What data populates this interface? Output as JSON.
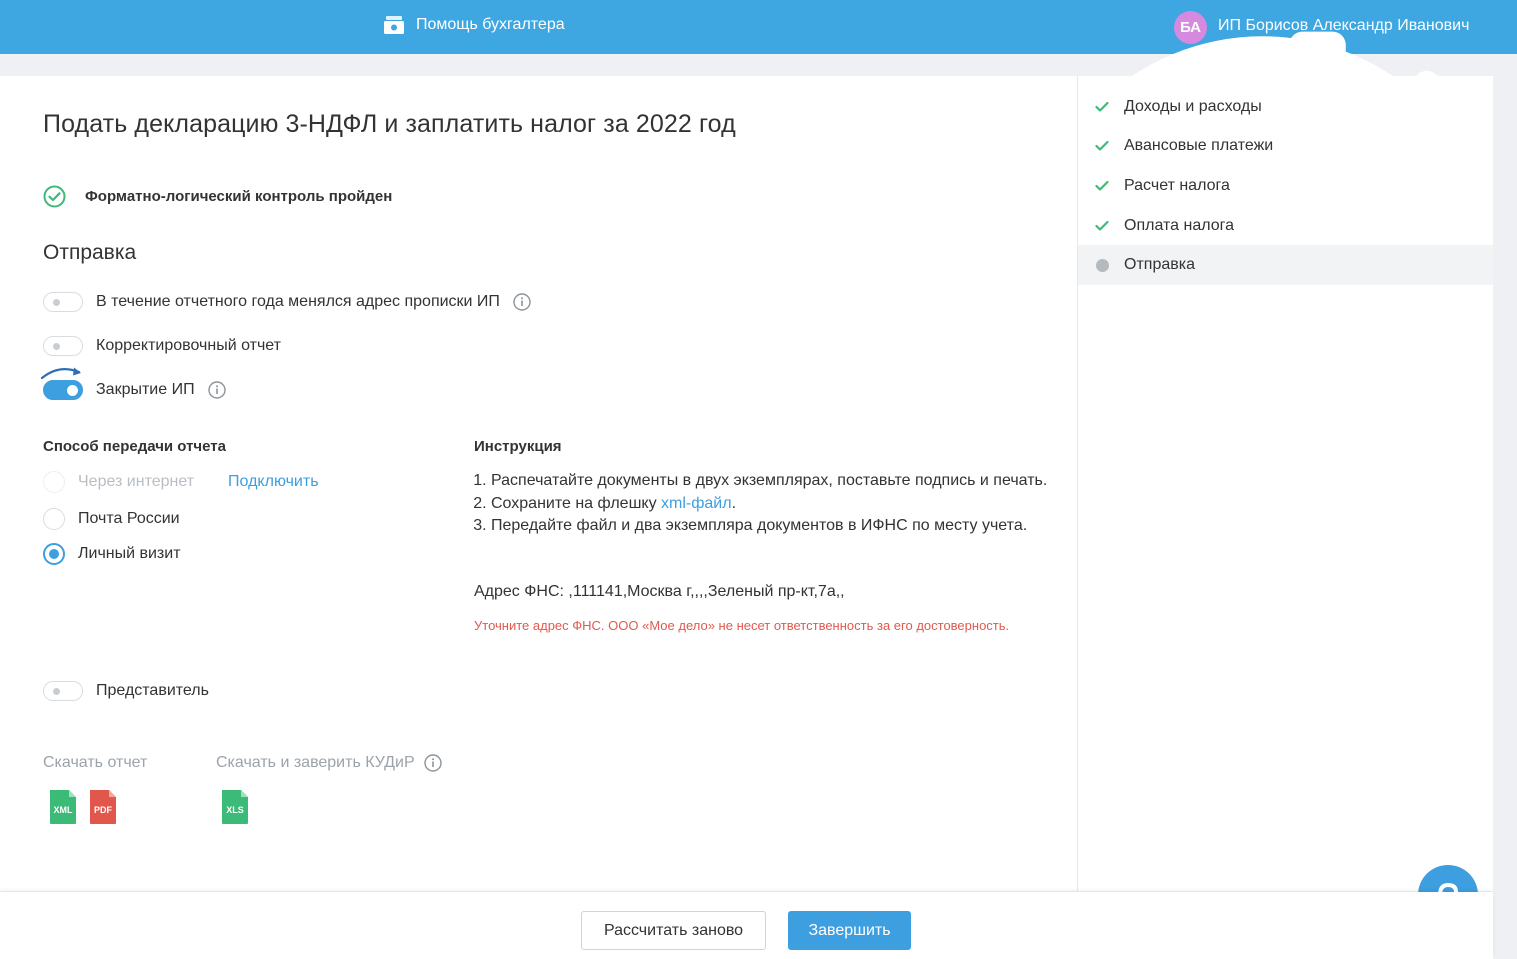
{
  "header": {
    "helper_label": "Помощь бухгалтера",
    "avatar_initials": "БА",
    "user_name": "ИП Борисов Александр Иванович",
    "icons": [
      "help-icon",
      "bell-icon",
      "gear-icon"
    ]
  },
  "page": {
    "title": "Подать декларацию 3-НДФЛ и заплатить налог за 2022 год",
    "flk_status": "Форматно-логический контроль пройден",
    "section_title": "Отправка"
  },
  "toggles": [
    {
      "label": "В течение отчетного года менялся адрес прописки ИП",
      "on": false,
      "info": true
    },
    {
      "label": "Корректировочный отчет",
      "on": false,
      "info": false
    },
    {
      "label": "Закрытие ИП",
      "on": true,
      "info": true
    }
  ],
  "transfer": {
    "title": "Способ передачи отчета",
    "options": [
      {
        "label": "Через интернет",
        "disabled": true,
        "checked": false
      },
      {
        "label": "Почта России",
        "disabled": false,
        "checked": false
      },
      {
        "label": "Личный визит",
        "disabled": false,
        "checked": true
      }
    ],
    "connect_link": "Подключить"
  },
  "instruction": {
    "title": "Инструкция",
    "step1": "Распечатайте документы в двух экземплярах, поставьте подпись и печать.",
    "step2_prefix": "Сохраните на флешку ",
    "step2_link": "xml-файл",
    "step2_suffix": ".",
    "step3": "Передайте файл и два экземпляра документов в ИФНС по месту учета.",
    "address": "Адрес ФНС: ,111141,Москва г,,,,Зеленый пр-кт,7а,,",
    "warning": "Уточните адрес ФНС. ООО «Мое дело» не несет ответственность за его достоверность."
  },
  "representative": {
    "label": "Представитель",
    "on": false
  },
  "downloads": {
    "report_label": "Скачать отчет",
    "kudir_label": "Скачать и заверить КУДиР",
    "files": {
      "xml": "XML",
      "pdf": "PDF",
      "xls": "XLS"
    }
  },
  "steps": [
    {
      "label": "Доходы и расходы",
      "done": true
    },
    {
      "label": "Авансовые платежи",
      "done": true
    },
    {
      "label": "Расчет налога",
      "done": true
    },
    {
      "label": "Оплата налога",
      "done": true
    },
    {
      "label": "Отправка",
      "done": false,
      "active": true
    }
  ],
  "footer": {
    "recalc_label": "Рассчитать заново",
    "finish_label": "Завершить"
  },
  "colors": {
    "accent": "#3d9ee0",
    "header_bg": "#3ea6e0",
    "success": "#3cba78",
    "warning": "#e05a4e",
    "xml_file": "#3cba78",
    "pdf_file": "#e2574c",
    "xls_file": "#3cba78"
  }
}
